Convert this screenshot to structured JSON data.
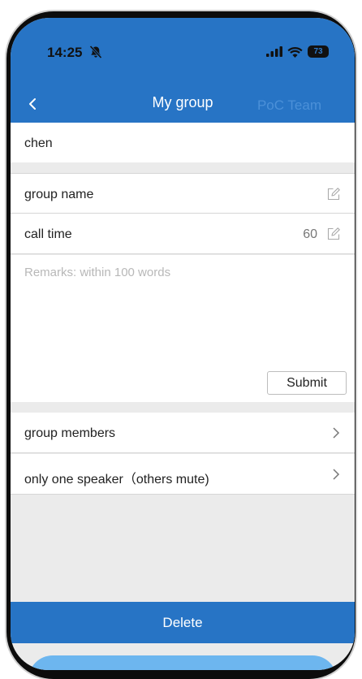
{
  "status_bar": {
    "time": "14:25",
    "battery_level": "73"
  },
  "header": {
    "title": "My group",
    "brand": "PoC Team"
  },
  "user": {
    "name": "chen"
  },
  "fields": {
    "group_name_label": "group name",
    "call_time_label": "call time",
    "call_time_value": "60"
  },
  "remarks": {
    "placeholder": "Remarks: within 100 words",
    "submit_label": "Submit"
  },
  "menu": {
    "group_members": "group members",
    "only_one_speaker": "only one speaker（others mute)"
  },
  "actions": {
    "delete_label": "Delete"
  },
  "colors": {
    "primary": "#2774c5",
    "background": "#ebebeb",
    "bottom_pill": "#6db6ef"
  }
}
